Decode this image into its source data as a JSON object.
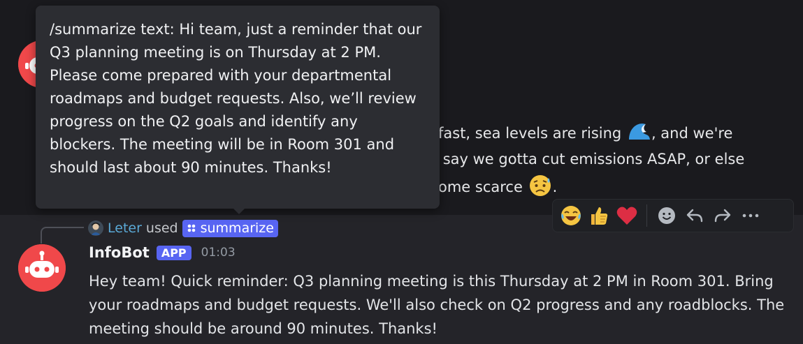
{
  "previous_message": {
    "lines": [
      "fast, sea levels are rising ",
      " say we gotta cut emissions ASAP, or else",
      "ome scarce "
    ],
    "line1_suffix": ", and we're",
    "line3_suffix": "."
  },
  "command_reference": {
    "user": "Leter",
    "used_text": "used",
    "command": "summarize"
  },
  "message": {
    "author": "InfoBot",
    "badge": "APP",
    "timestamp": "01:03",
    "body": "Hey team! Quick reminder: Q3 planning meeting is this Thursday at 2 PM in Room 301. Bring your roadmaps and budget requests. We'll also check on Q2 progress and any roadblocks. The meeting should be around 90 minutes. Thanks!"
  },
  "tooltip": {
    "text": "/summarize text: Hi team, just a reminder that our Q3 planning meeting is on Thursday at 2 PM. Please come prepared with your departmental roadmaps and budget requests. Also, we’ll review progress on the Q2 goals and identify any blockers. The meeting will be in Room 301 and should last about 90 minutes. Thanks!"
  },
  "action_bar": {
    "items": [
      {
        "icon": "joy-emoji-icon"
      },
      {
        "icon": "thumbs-up-emoji-icon"
      },
      {
        "icon": "heart-emoji-icon"
      },
      {
        "icon": "add-reaction-icon"
      },
      {
        "icon": "reply-icon"
      },
      {
        "icon": "forward-icon"
      },
      {
        "icon": "more-icon"
      }
    ]
  },
  "colors": {
    "background": "#1a1a1e",
    "highlight_row": "#242429",
    "accent": "#5865f2",
    "avatar_red": "#f0484a",
    "username_blue": "#5aa9d6",
    "tooltip_bg": "#2c2d32"
  }
}
